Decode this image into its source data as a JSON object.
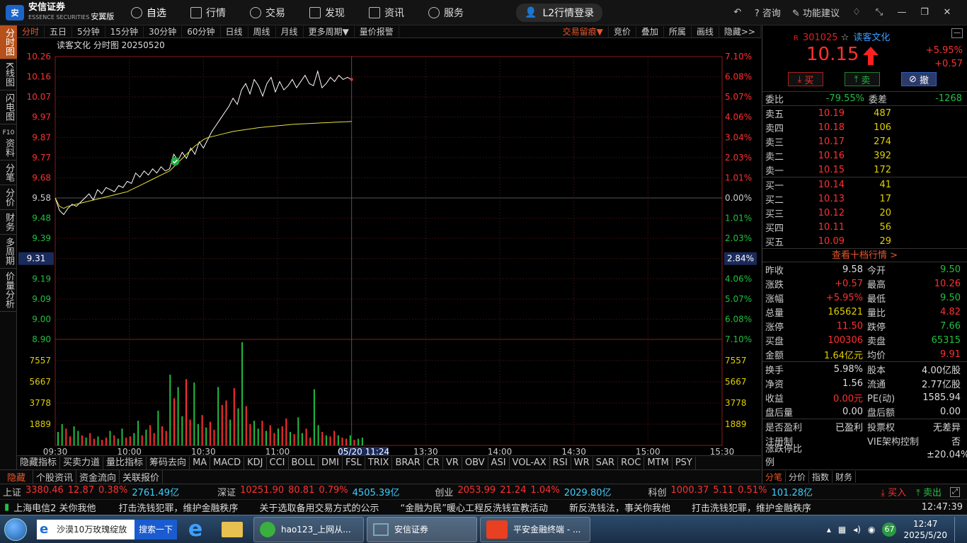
{
  "app": {
    "logo_text": "安信证券",
    "logo_sub": "ESSENCE SECURITIES",
    "logo_edition": "安翼版",
    "nav": [
      {
        "label": "自选",
        "icon": "star-circle-icon"
      },
      {
        "label": "行情",
        "icon": "chart-icon"
      },
      {
        "label": "交易",
        "icon": "trade-icon"
      },
      {
        "label": "发现",
        "icon": "grid-icon"
      },
      {
        "label": "资讯",
        "icon": "news-icon"
      },
      {
        "label": "服务",
        "icon": "service-icon"
      }
    ],
    "login": "L2行情登录",
    "right_links": [
      "咨询",
      "功能建议"
    ]
  },
  "left_tabs": [
    "分时图",
    "K线图",
    "闪电图",
    "资料",
    "分笔",
    "分价",
    "财务",
    "多周期",
    "价量分析"
  ],
  "left_tab_f10": "F10",
  "period_bar": {
    "items": [
      "分时",
      "五日",
      "5分钟",
      "15分钟",
      "30分钟",
      "60分钟",
      "日线",
      "周线",
      "月线",
      "更多周期▼",
      "量价报警"
    ],
    "right": [
      "交易留痕▼",
      "竞价",
      "叠加",
      "所属",
      "画线",
      "隐藏>>"
    ]
  },
  "chart_data": {
    "type": "line",
    "title": "读客文化 分时图 20250520",
    "prev_close": 9.58,
    "price_axis": [
      "10.26",
      "10.16",
      "10.07",
      "9.97",
      "9.87",
      "9.77",
      "9.68",
      "9.58",
      "9.48",
      "9.39",
      "9.31",
      "9.19",
      "9.09",
      "9.00",
      "8.90"
    ],
    "pct_axis": [
      "7.10%",
      "6.08%",
      "5.07%",
      "4.06%",
      "3.04%",
      "2.03%",
      "1.01%",
      "0.00%",
      "1.01%",
      "2.03%",
      "2.84%",
      "4.06%",
      "5.07%",
      "6.08%",
      "7.10%"
    ],
    "cursor_price": "9.31",
    "cursor_pct": "2.84%",
    "vol_axis": [
      "7557",
      "5667",
      "3778",
      "1889"
    ],
    "time_axis": [
      "09:30",
      "10:00",
      "10:30",
      "11:00",
      "05/20 11:24",
      "13:30",
      "14:00",
      "14:30",
      "15:00",
      "15:30"
    ],
    "ylim": [
      8.9,
      10.26
    ],
    "series": [
      {
        "name": "price",
        "color": "#ffffff",
        "values": [
          9.58,
          9.52,
          9.5,
          9.53,
          9.55,
          9.54,
          9.56,
          9.58,
          9.6,
          9.57,
          9.62,
          9.6,
          9.63,
          9.62,
          9.61,
          9.64,
          9.63,
          9.66,
          9.65,
          9.7,
          9.68,
          9.71,
          9.69,
          9.72,
          9.7,
          9.73,
          9.71,
          9.72,
          9.79,
          9.76,
          9.8,
          9.77,
          9.82,
          9.79,
          9.85,
          9.82,
          9.86,
          9.9,
          9.93,
          9.96,
          9.99,
          10.02,
          10.06,
          10.03,
          10.1,
          10.13,
          10.08,
          10.15,
          10.12,
          10.07,
          10.13,
          10.16,
          10.09,
          10.14,
          10.1,
          10.12,
          10.15,
          10.11,
          10.14,
          10.17,
          10.13,
          10.12,
          10.19,
          10.11,
          10.13,
          10.16,
          10.14,
          10.17,
          10.15,
          10.16,
          10.15
        ]
      },
      {
        "name": "avg",
        "color": "#e8e040",
        "values": [
          9.58,
          9.54,
          9.53,
          9.54,
          9.545,
          9.55,
          9.555,
          9.56,
          9.565,
          9.57,
          9.575,
          9.58,
          9.585,
          9.59,
          9.595,
          9.6,
          9.605,
          9.61,
          9.62,
          9.63,
          9.64,
          9.65,
          9.66,
          9.67,
          9.68,
          9.69,
          9.7,
          9.71,
          9.73,
          9.75,
          9.77,
          9.79,
          9.81,
          9.83,
          9.845,
          9.86,
          9.87,
          9.875,
          9.88,
          9.885,
          9.89,
          9.895,
          9.9,
          9.903,
          9.906,
          9.909,
          9.912,
          9.915,
          9.918,
          9.92,
          9.922,
          9.924,
          9.926,
          9.928,
          9.93,
          9.932,
          9.934,
          9.935,
          9.936,
          9.937,
          9.938,
          9.939,
          9.94,
          9.941,
          9.942,
          9.943,
          9.944,
          9.945,
          9.946,
          9.947,
          9.948
        ]
      }
    ],
    "volume": [
      1200,
      1900,
      1500,
      800,
      1700,
      1300,
      900,
      700,
      1100,
      600,
      800,
      500,
      700,
      1300,
      900,
      600,
      1500,
      700,
      800,
      1100,
      2200,
      900,
      1400,
      1800,
      1100,
      3100,
      1700,
      1300,
      6300,
      4200,
      5200,
      2600,
      5900,
      2300,
      5600,
      1900,
      2700,
      1600,
      2100,
      1400,
      5200,
      3600,
      4000,
      2300,
      5100,
      3300,
      9300,
      3500,
      1900,
      2200,
      1500,
      2200,
      1300,
      1800,
      1100,
      1500,
      1700,
      2400,
      1200,
      1000,
      2500,
      1100,
      1500,
      700,
      5000,
      1800,
      1200,
      900,
      800,
      1300,
      900,
      700,
      600,
      900,
      500,
      600,
      700
    ]
  },
  "markers": {
    "signal_icon": "check-circle-icon"
  },
  "indicator_bar": [
    "隐藏指标",
    "买卖力道",
    "量比指标",
    "筹码去向",
    "MA",
    "MACD",
    "KDJ",
    "CCI",
    "BOLL",
    "DMI",
    "FSL",
    "TRIX",
    "BRAR",
    "CR",
    "VR",
    "OBV",
    "ASI",
    "VOL-AX",
    "RSI",
    "WR",
    "SAR",
    "ROC",
    "MTM",
    "PSY"
  ],
  "info_bar": [
    "隐藏",
    "个股资讯",
    "资金流向",
    "关联报价"
  ],
  "stock": {
    "r_mark": "R",
    "code": "301025",
    "name": "读客文化",
    "price": "10.15",
    "change_pct": "+5.95%",
    "change": "+0.57",
    "buy_btn": "买",
    "sell_btn": "卖",
    "cancel_btn": "撤",
    "webi_label": "委比",
    "webi": "-79.55%",
    "weicha_label": "委差",
    "weicha": "-1268",
    "asks": [
      {
        "label": "卖五",
        "price": "10.19",
        "vol": "487"
      },
      {
        "label": "卖四",
        "price": "10.18",
        "vol": "106"
      },
      {
        "label": "卖三",
        "price": "10.17",
        "vol": "274"
      },
      {
        "label": "卖二",
        "price": "10.16",
        "vol": "392"
      },
      {
        "label": "卖一",
        "price": "10.15",
        "vol": "172"
      }
    ],
    "bids": [
      {
        "label": "买一",
        "price": "10.14",
        "vol": "41"
      },
      {
        "label": "买二",
        "price": "10.13",
        "vol": "17"
      },
      {
        "label": "买三",
        "price": "10.12",
        "vol": "20"
      },
      {
        "label": "买四",
        "price": "10.11",
        "vol": "56"
      },
      {
        "label": "买五",
        "price": "10.09",
        "vol": "29"
      }
    ],
    "more_link": "查看十档行情 >",
    "stats": [
      [
        "昨收",
        "9.58",
        "white",
        "今开",
        "9.50",
        "green"
      ],
      [
        "涨跌",
        "+0.57",
        "red",
        "最高",
        "10.26",
        "red"
      ],
      [
        "涨幅",
        "+5.95%",
        "red",
        "最低",
        "9.50",
        "green"
      ],
      [
        "总量",
        "165621",
        "yellow",
        "量比",
        "4.82",
        "red"
      ],
      [
        "涨停",
        "11.50",
        "red",
        "跌停",
        "7.66",
        "green"
      ],
      [
        "买盘",
        "100306",
        "red",
        "卖盘",
        "65315",
        "green"
      ],
      [
        "金额",
        "1.64亿元",
        "yellow",
        "均价",
        "9.91",
        "red"
      ]
    ],
    "stats2": [
      [
        "换手",
        "5.98%",
        "white",
        "股本",
        "4.00亿股",
        "white"
      ],
      [
        "净资",
        "1.56",
        "white",
        "流通",
        "2.77亿股",
        "white"
      ],
      [
        "收益",
        "0.00元",
        "red",
        "PE(动)",
        "1585.94",
        "white"
      ],
      [
        "盘后量",
        "0.00",
        "white",
        "盘后额",
        "0.00",
        "white"
      ]
    ],
    "stats3": [
      [
        "是否盈利",
        "已盈利",
        "投票权",
        "无差异"
      ],
      [
        "注册制",
        "",
        "VIE架构控制",
        "否"
      ],
      [
        "涨跌停比例",
        "",
        "",
        "±20.04%"
      ]
    ],
    "bottom_tabs": [
      "分笔",
      "分价",
      "指数",
      "财务"
    ]
  },
  "indices": [
    {
      "name": "上证",
      "value": "3380.46",
      "chg": "12.87",
      "pct": "0.38%",
      "amt": "2761.49亿"
    },
    {
      "name": "深证",
      "value": "10251.90",
      "chg": "80.81",
      "pct": "0.79%",
      "amt": "4505.39亿"
    },
    {
      "name": "创业",
      "value": "2053.99",
      "chg": "21.24",
      "pct": "1.04%",
      "amt": "2029.80亿"
    },
    {
      "name": "科创",
      "value": "1000.37",
      "chg": "5.11",
      "pct": "0.51%",
      "amt": "101.28亿"
    }
  ],
  "index_actions": {
    "buy": "买入",
    "sell": "卖出"
  },
  "news": {
    "source": "上海电信2",
    "items": [
      "关你我他",
      "打击洗钱犯罪，维护金融秩序",
      "关于选取备用交易方式的公示",
      "“金融为民”暖心工程反洗钱宣教活动",
      "新反洗钱法，事关你我他",
      "打击洗钱犯罪，维护金融秩序"
    ],
    "time": "12:47:39"
  },
  "taskbar": {
    "search_text": "沙漠10万玫瑰绽放",
    "search_btn": "搜索一下",
    "apps": [
      {
        "label": "hao123_上网从...",
        "icon": "browser-icon"
      },
      {
        "label": "安信证券",
        "icon": "app-window-icon"
      },
      {
        "label": "平安金融终端 - ...",
        "icon": "pingan-icon"
      }
    ],
    "badge": "67",
    "time": "12:47",
    "date": "2025/5/20"
  }
}
